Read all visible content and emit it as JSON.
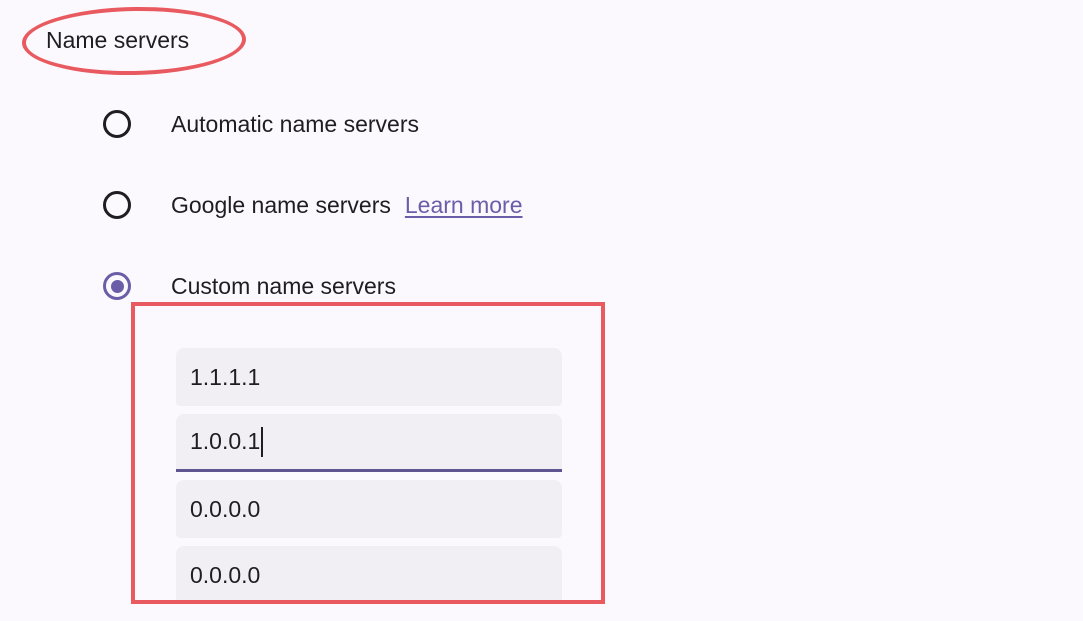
{
  "section": {
    "title": "Name servers"
  },
  "options": [
    {
      "label": "Automatic name servers",
      "checked": false
    },
    {
      "label": "Google name servers",
      "link": "Learn more",
      "checked": false
    },
    {
      "label": "Custom name servers",
      "checked": true
    }
  ],
  "custom_servers": {
    "fields": [
      {
        "value": "1.1.1.1",
        "focused": false
      },
      {
        "value": "1.0.0.1",
        "focused": true
      },
      {
        "value": "0.0.0.0",
        "focused": false
      },
      {
        "value": "0.0.0.0",
        "focused": false
      }
    ]
  },
  "colors": {
    "accent": "#6b5ea8",
    "annotation": "#e85a5f",
    "field_background": "#f2eff4",
    "page_background": "#fbf9fd"
  }
}
